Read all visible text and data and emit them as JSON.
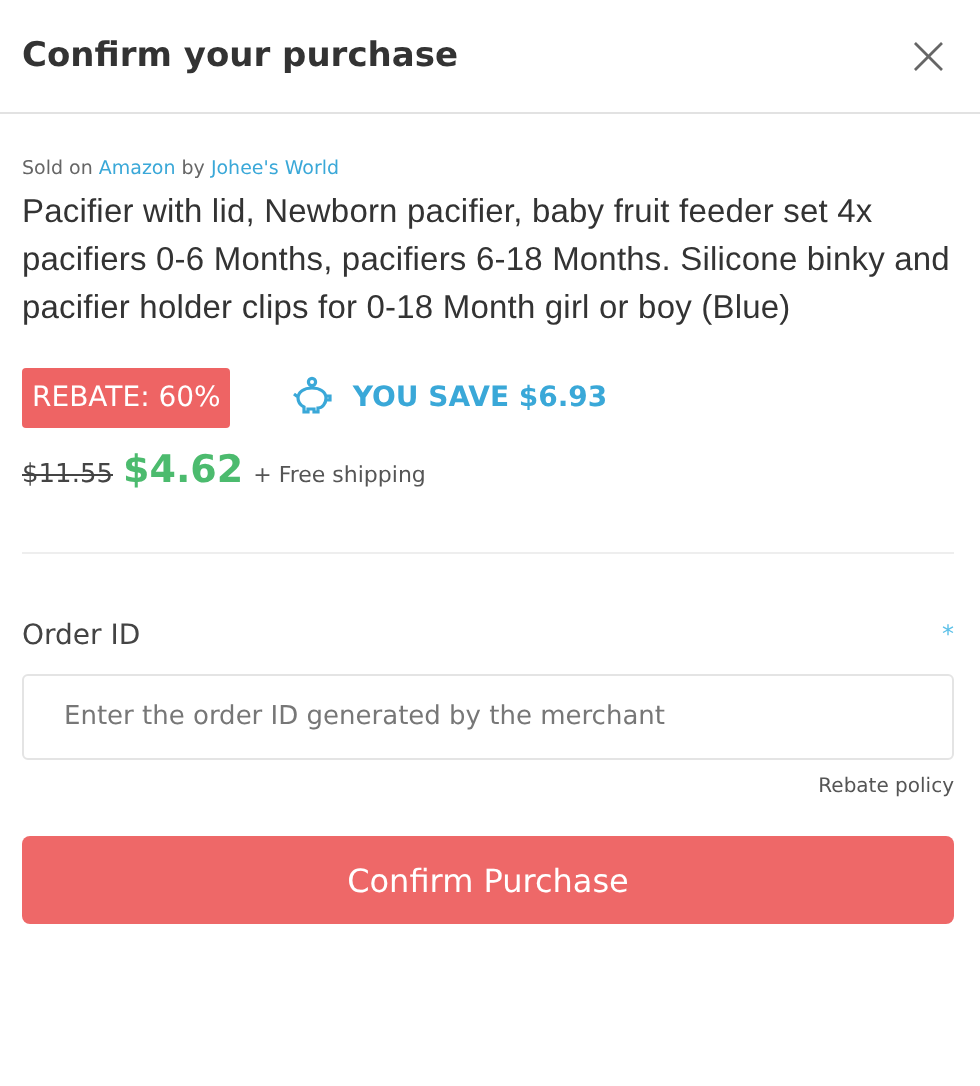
{
  "dialog": {
    "title": "Confirm your purchase",
    "close": "×"
  },
  "product": {
    "sold_on_prefix": "Sold on",
    "marketplace": "Amazon",
    "by": "by",
    "seller": "Johee's World",
    "title": "Pacifier with lid, Newborn pacifier, baby fruit feeder set 4x pacifiers 0-6 Months, pacifiers 6-18 Months. Silicone binky and pacifier holder clips for 0-18 Month girl or boy (Blue)"
  },
  "rebate": {
    "badge": "REBATE: 60%",
    "savings": "YOU SAVE $6.93"
  },
  "price": {
    "original": "$11.55",
    "current": "$4.62",
    "shipping": "+ Free shipping"
  },
  "order_field": {
    "label": "Order ID",
    "required_mark": "*",
    "placeholder": "Enter the order ID generated by the merchant"
  },
  "policy_link": "Rebate policy",
  "confirm_button": "Confirm Purchase"
}
